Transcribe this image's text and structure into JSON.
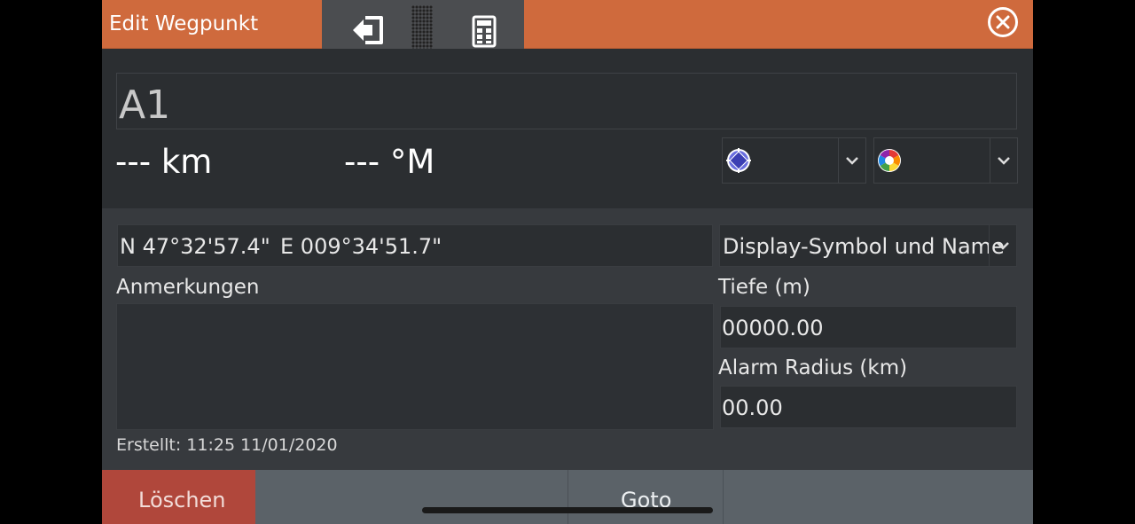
{
  "dialog": {
    "title": "Edit Wegpunkt",
    "colors": {
      "titlebar": "#cf6a3d",
      "delete": "#b0473b",
      "background": "#2b2e31"
    }
  },
  "toolbar": {
    "icons": [
      "exit-icon",
      "drag-grip-icon",
      "keypad-icon"
    ]
  },
  "waypoint": {
    "name": "A1",
    "distance": "--- km",
    "bearing": "--- °M",
    "symbol_icon": "waypoint-symbol-icon",
    "color_icon": "color-wheel-icon"
  },
  "position": {
    "latitude": "N 47°32'57.4\"",
    "longitude": "E 009°34'51.7\""
  },
  "display_mode": "Display-Symbol und Name",
  "notes": {
    "label": "Anmerkungen",
    "value": ""
  },
  "depth": {
    "label": "Tiefe (m)",
    "value": "00000.00"
  },
  "alarm_radius": {
    "label": "Alarm Radius (km)",
    "value": "00.00"
  },
  "created": "Erstellt: 11:25  11/01/2020",
  "buttons": {
    "delete": "Löschen",
    "goto": "Goto"
  }
}
